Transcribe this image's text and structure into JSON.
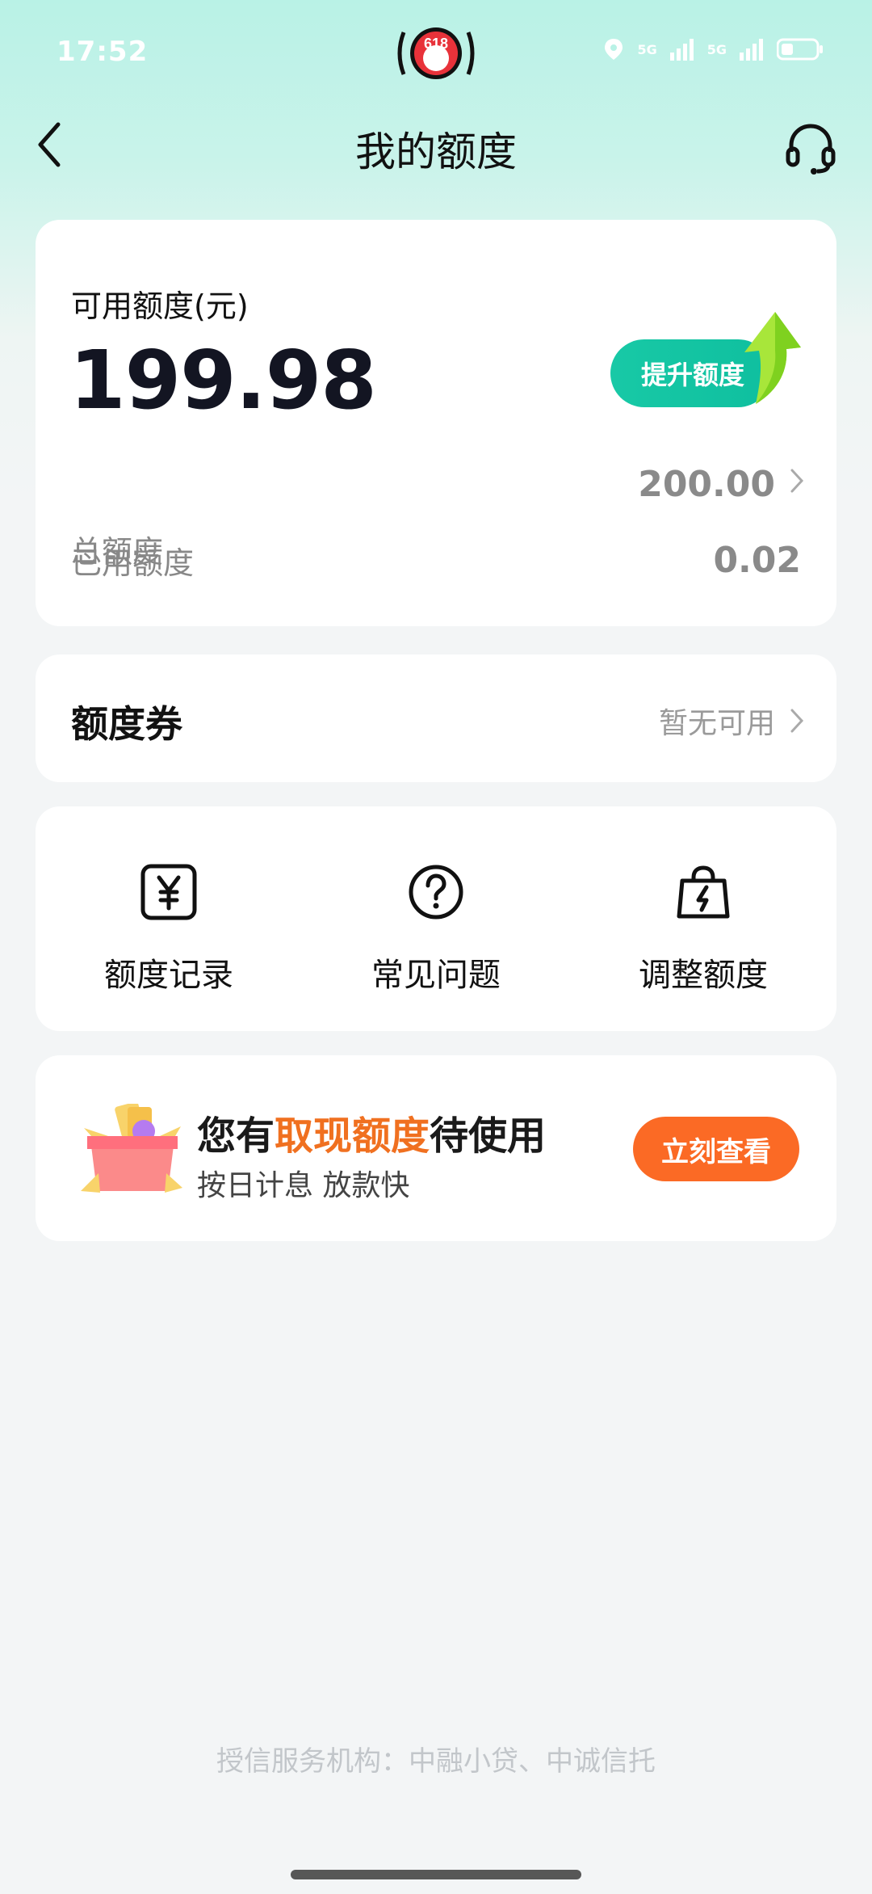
{
  "status_bar": {
    "time": "17:52",
    "center_badge": "618",
    "signal_1": "5G",
    "signal_2": "5G"
  },
  "nav": {
    "title": "我的额度",
    "back_icon": "back-arrow-icon",
    "service_icon": "headset-icon"
  },
  "quota": {
    "available_label": "可用额度(元)",
    "available_value": "199.98",
    "raise_button": "提升额度",
    "total_label": "总额度",
    "total_value": "200.00",
    "used_label": "已用额度",
    "used_value": "0.02"
  },
  "coupon": {
    "label": "额度券",
    "status": "暂无可用"
  },
  "features": [
    {
      "label": "额度记录",
      "icon": "yen-record-icon"
    },
    {
      "label": "常见问题",
      "icon": "question-icon"
    },
    {
      "label": "调整额度",
      "icon": "bag-bolt-icon"
    }
  ],
  "promo": {
    "title_prefix": "您有",
    "title_highlight": "取现额度",
    "title_suffix": "待使用",
    "subtitle": "按日计息 放款快",
    "button": "立刻查看"
  },
  "footer": {
    "text": "授信服务机构：中融小贷、中诚信托"
  },
  "colors": {
    "accent_green": "#18c9a6",
    "promo_orange": "#fb6a25",
    "highlight_orange": "#f07020"
  }
}
